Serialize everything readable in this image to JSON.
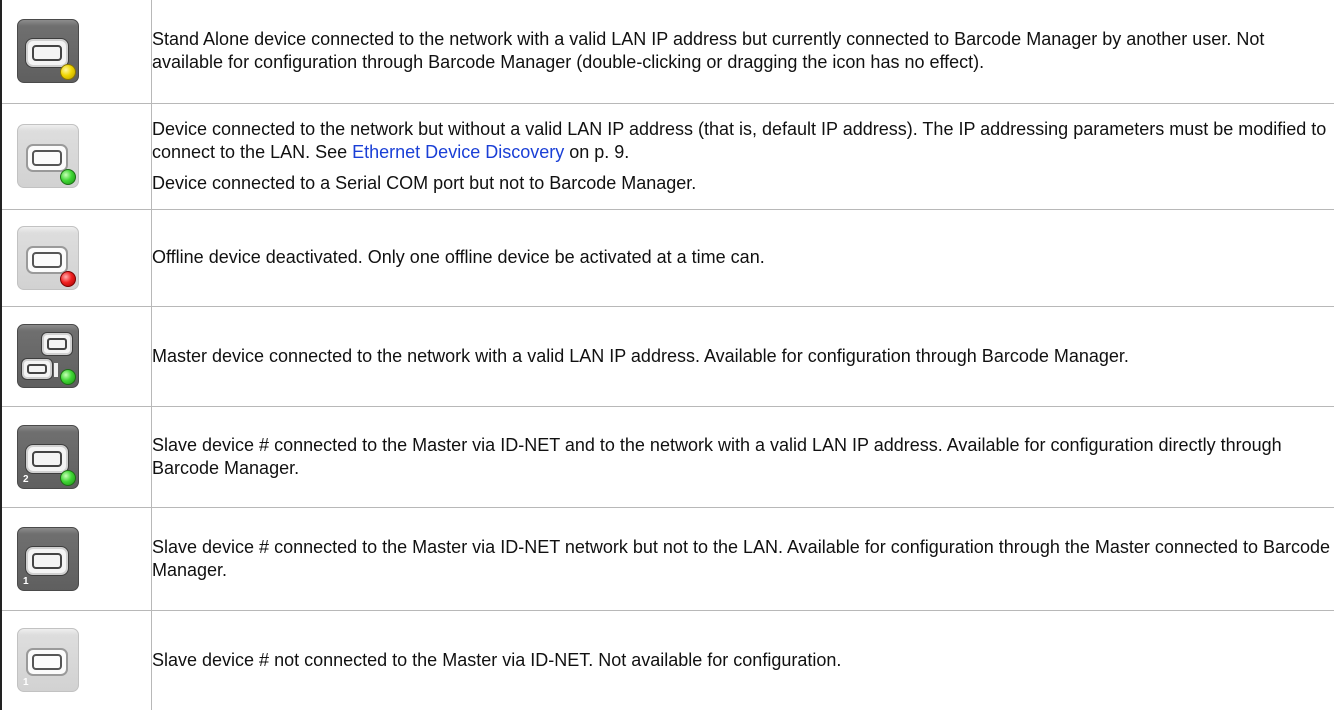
{
  "rows": [
    {
      "icon": "standalone-device-busy-icon",
      "variant": "dark",
      "status_color": "#e6cc00",
      "paragraphs": [
        "Stand Alone device connected to the network with a valid LAN IP address but currently connected to Barcode Manager by another user. Not available for configuration through Barcode Manager (double-clicking or dragging the icon has no effect)."
      ]
    },
    {
      "icon": "device-no-valid-ip-icon",
      "variant": "light",
      "status_color": "#3fd634",
      "paragraph1_before_link": "Device connected to the network but without a valid LAN IP address (that is, default IP address). The IP addressing parameters must be modified to connect to the LAN. See ",
      "link_text": "Ethernet Device Discovery",
      "paragraph1_after_link": " on p. 9.",
      "paragraph2": "Device connected to a Serial COM port but not to Barcode Manager."
    },
    {
      "icon": "offline-device-deactivated-icon",
      "variant": "light",
      "status_color": "#f02020",
      "paragraphs": [
        "Offline device deactivated. Only one offline device be activated at a time can."
      ]
    },
    {
      "icon": "master-device-icon",
      "variant": "dark",
      "status_color": "#3fd634",
      "paragraphs": [
        "Master device connected to the network with a valid LAN IP address. Available for configuration through Barcode Manager."
      ]
    },
    {
      "icon": "slave-device-lan-icon",
      "variant": "dark",
      "status_color": "#3fd634",
      "number": "2",
      "paragraphs": [
        "Slave device # connected to the Master via ID-NET and to the network with a valid LAN IP address. Available for configuration directly through Barcode Manager."
      ]
    },
    {
      "icon": "slave-device-idnet-icon",
      "variant": "dark",
      "number": "1",
      "paragraphs": [
        "Slave device # connected to the Master via ID-NET network but not to the LAN. Available for configuration through the Master connected to Barcode Manager."
      ]
    },
    {
      "icon": "slave-device-disconnected-icon",
      "variant": "light",
      "number": "1",
      "paragraphs": [
        "Slave device # not connected to the Master via ID-NET. Not available for configuration."
      ]
    }
  ],
  "colors": {
    "link": "#1a3fd6",
    "rule": "#b8b8b8"
  }
}
